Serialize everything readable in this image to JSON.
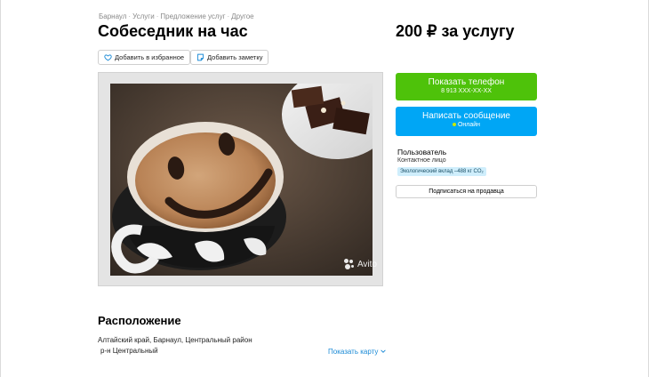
{
  "breadcrumbs": [
    "Барнаул",
    "Услуги",
    "Предложение услуг",
    "Другое"
  ],
  "listing": {
    "title": "Собеседник на час",
    "price": "200 ₽ за услугу"
  },
  "actions": {
    "favorite_label": "Добавить в избранное",
    "note_label": "Добавить заметку"
  },
  "photo": {
    "watermark": "Avito"
  },
  "contact": {
    "phone_button_label": "Показать телефон",
    "phone_masked": "8 913 XXX-XX-XX",
    "message_button_label": "Написать сообщение",
    "online_status": "Онлайн"
  },
  "seller": {
    "name": "Пользователь",
    "role": "Контактное лицо",
    "eco_badge": "Экологический вклад –488 кг CO₂",
    "subscribe_label": "Подписаться на продавца"
  },
  "location": {
    "title": "Расположение",
    "address": "Алтайский край, Барнаул, Центральный район",
    "district": "р-н Центральный",
    "map_link": "Показать карту"
  },
  "colors": {
    "phone_button": "#4ec20a",
    "message_button": "#00a6f5",
    "link": "#1a8ad6",
    "eco_badge_bg": "#cfeefc"
  },
  "icons": {
    "favorite": "heart-icon",
    "note": "note-icon",
    "map_link": "chevron-down-icon"
  }
}
